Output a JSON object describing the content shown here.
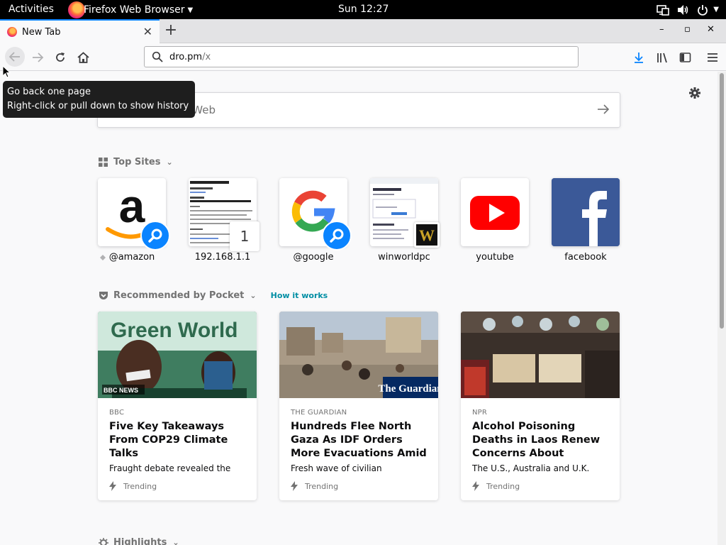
{
  "topbar": {
    "activities": "Activities",
    "app_name": "Firefox Web Browser",
    "clock": "Sun 12:27",
    "icons": [
      "network-icon",
      "volume-icon",
      "power-icon",
      "chevron-down-icon"
    ]
  },
  "tabs": [
    {
      "title": "New Tab",
      "active": true
    }
  ],
  "window_controls": {
    "minimize": "–",
    "maximize": "▫",
    "close": "✕"
  },
  "url_bar": {
    "host": "dro.pm",
    "path": "/x"
  },
  "toolbar_icons": [
    "back-icon",
    "forward-icon",
    "reload-icon",
    "home-icon",
    "download-icon",
    "library-icon",
    "sidebar-icon",
    "menu-icon"
  ],
  "search": {
    "placeholder": "Web"
  },
  "top_sites": {
    "title": "Top Sites",
    "items": [
      {
        "label": "@amazon",
        "pinned": true
      },
      {
        "label": "192.168.1.1",
        "badge": "1"
      },
      {
        "label": "@google"
      },
      {
        "label": "winworldpc"
      },
      {
        "label": "youtube"
      },
      {
        "label": "facebook"
      }
    ]
  },
  "pocket": {
    "title": "Recommended by Pocket",
    "how_it_works": "How it works",
    "cards": [
      {
        "source": "BBC",
        "headline": "Five Key Takeaways From COP29 Climate Talks",
        "excerpt": "Fraught debate revealed the",
        "context": "Trending",
        "image_text": "Green World",
        "image_badge": "BBC NEWS"
      },
      {
        "source": "THE GUARDIAN",
        "headline": "Hundreds Flee North Gaza As IDF Orders More Evacuations Amid",
        "excerpt": "Fresh wave of civilian",
        "context": "Trending",
        "image_badge": "The Guardian"
      },
      {
        "source": "NPR",
        "headline": "Alcohol Poisoning Deaths in Laos Renew Concerns About",
        "excerpt": "The U.S., Australia and U.K.",
        "context": "Trending"
      }
    ]
  },
  "highlights": {
    "title": "Highlights"
  },
  "tooltip": {
    "line1": "Go back one page",
    "line2": "Right-click or pull down to show history"
  },
  "colors": {
    "accent": "#0a84ff",
    "pocket_link": "#008ea4",
    "youtube": "#ff0000",
    "facebook": "#3b5998"
  }
}
